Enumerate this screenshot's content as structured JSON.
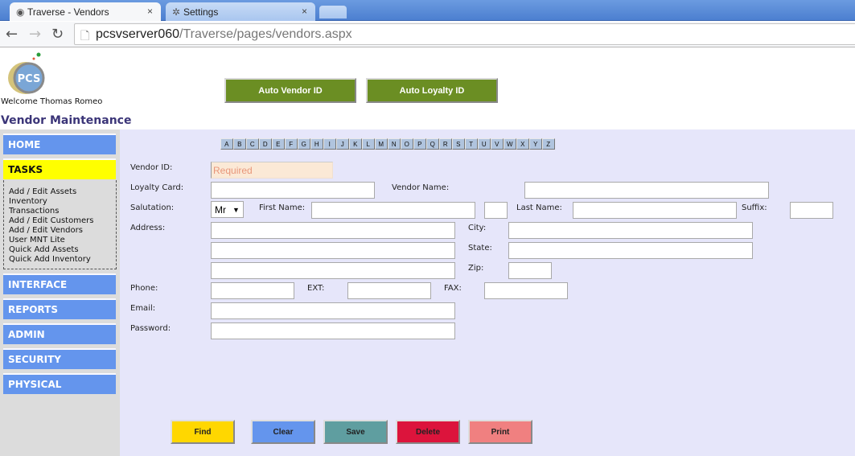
{
  "browser": {
    "tabs": [
      {
        "label": "Traverse - Vendors",
        "icon": "page-icon",
        "active": true
      },
      {
        "label": "Settings",
        "icon": "gear-icon",
        "active": false
      }
    ],
    "close_glyph": "×",
    "url_host": "pcsvserver060",
    "url_path": "/Traverse/pages/vendors.aspx"
  },
  "header": {
    "logo_text": "PCS",
    "welcome": "Welcome Thomas Romeo",
    "page_title": "Vendor Maintenance",
    "auto_vendor_id": "Auto Vendor ID",
    "auto_loyalty_id": "Auto Loyalty ID"
  },
  "sidebar": {
    "home": "HOME",
    "tasks": "TASKS",
    "task_links": [
      "Add / Edit Assets",
      "Inventory",
      "Transactions",
      "Add / Edit Customers",
      "Add / Edit Vendors",
      "User MNT Lite",
      "Quick Add Assets",
      "Quick Add Inventory"
    ],
    "sections": [
      "INTERFACE",
      "REPORTS",
      "ADMIN",
      "SECURITY",
      "PHYSICAL"
    ]
  },
  "alphabet": [
    "A",
    "B",
    "C",
    "D",
    "E",
    "F",
    "G",
    "H",
    "I",
    "J",
    "K",
    "L",
    "M",
    "N",
    "O",
    "P",
    "Q",
    "R",
    "S",
    "T",
    "U",
    "V",
    "W",
    "X",
    "Y",
    "Z"
  ],
  "form": {
    "vendor_id_label": "Vendor ID:",
    "vendor_id_placeholder": "Required",
    "loyalty_card_label": "Loyalty Card:",
    "vendor_name_label": "Vendor Name:",
    "salutation_label": "Salutation:",
    "salutation_value": "Mr",
    "first_name_label": "First Name:",
    "last_name_label": "Last Name:",
    "suffix_label": "Suffix:",
    "address_label": "Address:",
    "city_label": "City:",
    "state_label": "State:",
    "zip_label": "Zip:",
    "phone_label": "Phone:",
    "ext_label": "EXT:",
    "fax_label": "FAX:",
    "email_label": "Email:",
    "password_label": "Password:"
  },
  "actions": {
    "find": "Find",
    "clear": "Clear",
    "save": "Save",
    "delete": "Delete",
    "print": "Print"
  },
  "colors": {
    "auto_buttons": "#6b8e23",
    "sidebar_item": "#6495ed",
    "tasks_highlight": "#ffff00",
    "main_bg": "#e6e6fa",
    "find": "#ffd700",
    "clear": "#6495ed",
    "save": "#5f9ea0",
    "delete": "#dc143c",
    "print": "#f08080"
  }
}
